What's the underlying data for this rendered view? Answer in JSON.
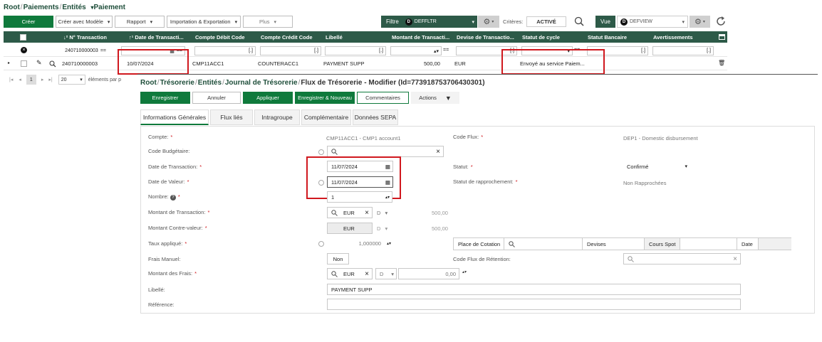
{
  "breadcrumb_top": {
    "root": "Root",
    "sep1": "/",
    "item1": "Paiements",
    "sep2": "/",
    "item2": "Entités",
    "item3": "Paiement"
  },
  "toolbar": {
    "create": "Créer",
    "create_model": "Créer avec Modèle",
    "report": "Rapport",
    "import_export": "Importation & Exportation",
    "more": "Plus",
    "filter_label": "Filtre",
    "filter_value": "DEFFLTR",
    "criteria_label": "Critères:",
    "criteria_value": "ACTIVÉ",
    "view_label": "Vue",
    "view_value": "DEFVIEW",
    "badge": "D"
  },
  "grid": {
    "columns": [
      "↓² N° Transaction",
      "↑¹ Date de Transacti...",
      "Compte Débit Code",
      "Compte Crédit Code",
      "Libellé",
      "Montant de Transacti...",
      "Devise de Transactio...",
      "Statut de cycle",
      "Statut Bancaire",
      "Avertissements"
    ],
    "filter_txn": "240710000003",
    "filter_eq": "==",
    "row": {
      "txn": "240710000003",
      "date": "10/07/2024",
      "debit": "CMP11ACC1",
      "credit": "COUNTERACC1",
      "label": "PAYMENT SUPP",
      "amount": "500,00",
      "currency": "EUR",
      "cycle": "Envoyé au service Paiem..."
    },
    "pager": {
      "page": "1",
      "size": "20",
      "per_page": "éléments par p"
    }
  },
  "breadcrumb_form": {
    "root": "Root",
    "sep": "/",
    "item1": "Trésorerie",
    "item2": "Entités",
    "item3": "Journal de Trésorerie",
    "item4": "Flux de Trésorerie - Modifier (Id=773918753706430301)"
  },
  "form_toolbar": {
    "save": "Enregistrer",
    "cancel": "Annuler",
    "apply": "Appliquer",
    "save_new": "Enregistrer & Nouveau",
    "comments": "Commentaires",
    "actions": "Actions"
  },
  "tabs": [
    "Informations Générales",
    "Flux liés",
    "Intragroupe",
    "Complémentaire",
    "Données SEPA"
  ],
  "form": {
    "compte_label": "Compte:",
    "compte_value": "CMP11ACC1 - CMP1 account1",
    "code_flux_label": "Code Flux:",
    "code_flux_value": "DEP1 - Domestic disbursement",
    "budget_label": "Code Budgétaire:",
    "txn_date_label": "Date de Transaction:",
    "txn_date_value": "11/07/2024",
    "statut_label": "Statut:",
    "statut_value": "Confirmé",
    "value_date_label": "Date de Valeur:",
    "value_date_value": "11/07/2024",
    "rappro_label": "Statut de rapprochement:",
    "rappro_value": "Non Rapprochées",
    "nombre_label": "Nombre:",
    "nombre_value": "1",
    "montant_label": "Montant de Transaction:",
    "montant_currency": "EUR",
    "montant_d": "D",
    "montant_value": "500,00",
    "contre_label": "Montant Contre-valeur:",
    "contre_currency": "EUR",
    "contre_d": "D",
    "contre_value": "500,00",
    "taux_label": "Taux appliqué:",
    "taux_value": "1,000000",
    "place_label": "Place de Cotation",
    "devises_label": "Devises",
    "cours_label": "Cours Spot",
    "date_label": "Date",
    "frais_manuel_label": "Frais Manuel:",
    "frais_manuel_value": "Non",
    "retention_label": "Code Flux de Rétention:",
    "frais_label": "Montant des Frais:",
    "frais_currency": "EUR",
    "frais_d": "D",
    "frais_value": "0,00",
    "libelle_label": "Libellé:",
    "libelle_value": "PAYMENT SUPP",
    "reference_label": "Référence:"
  },
  "colors": {
    "green": "#0f7a3c",
    "header": "#2d5a48",
    "highlight": "#d0181e"
  }
}
